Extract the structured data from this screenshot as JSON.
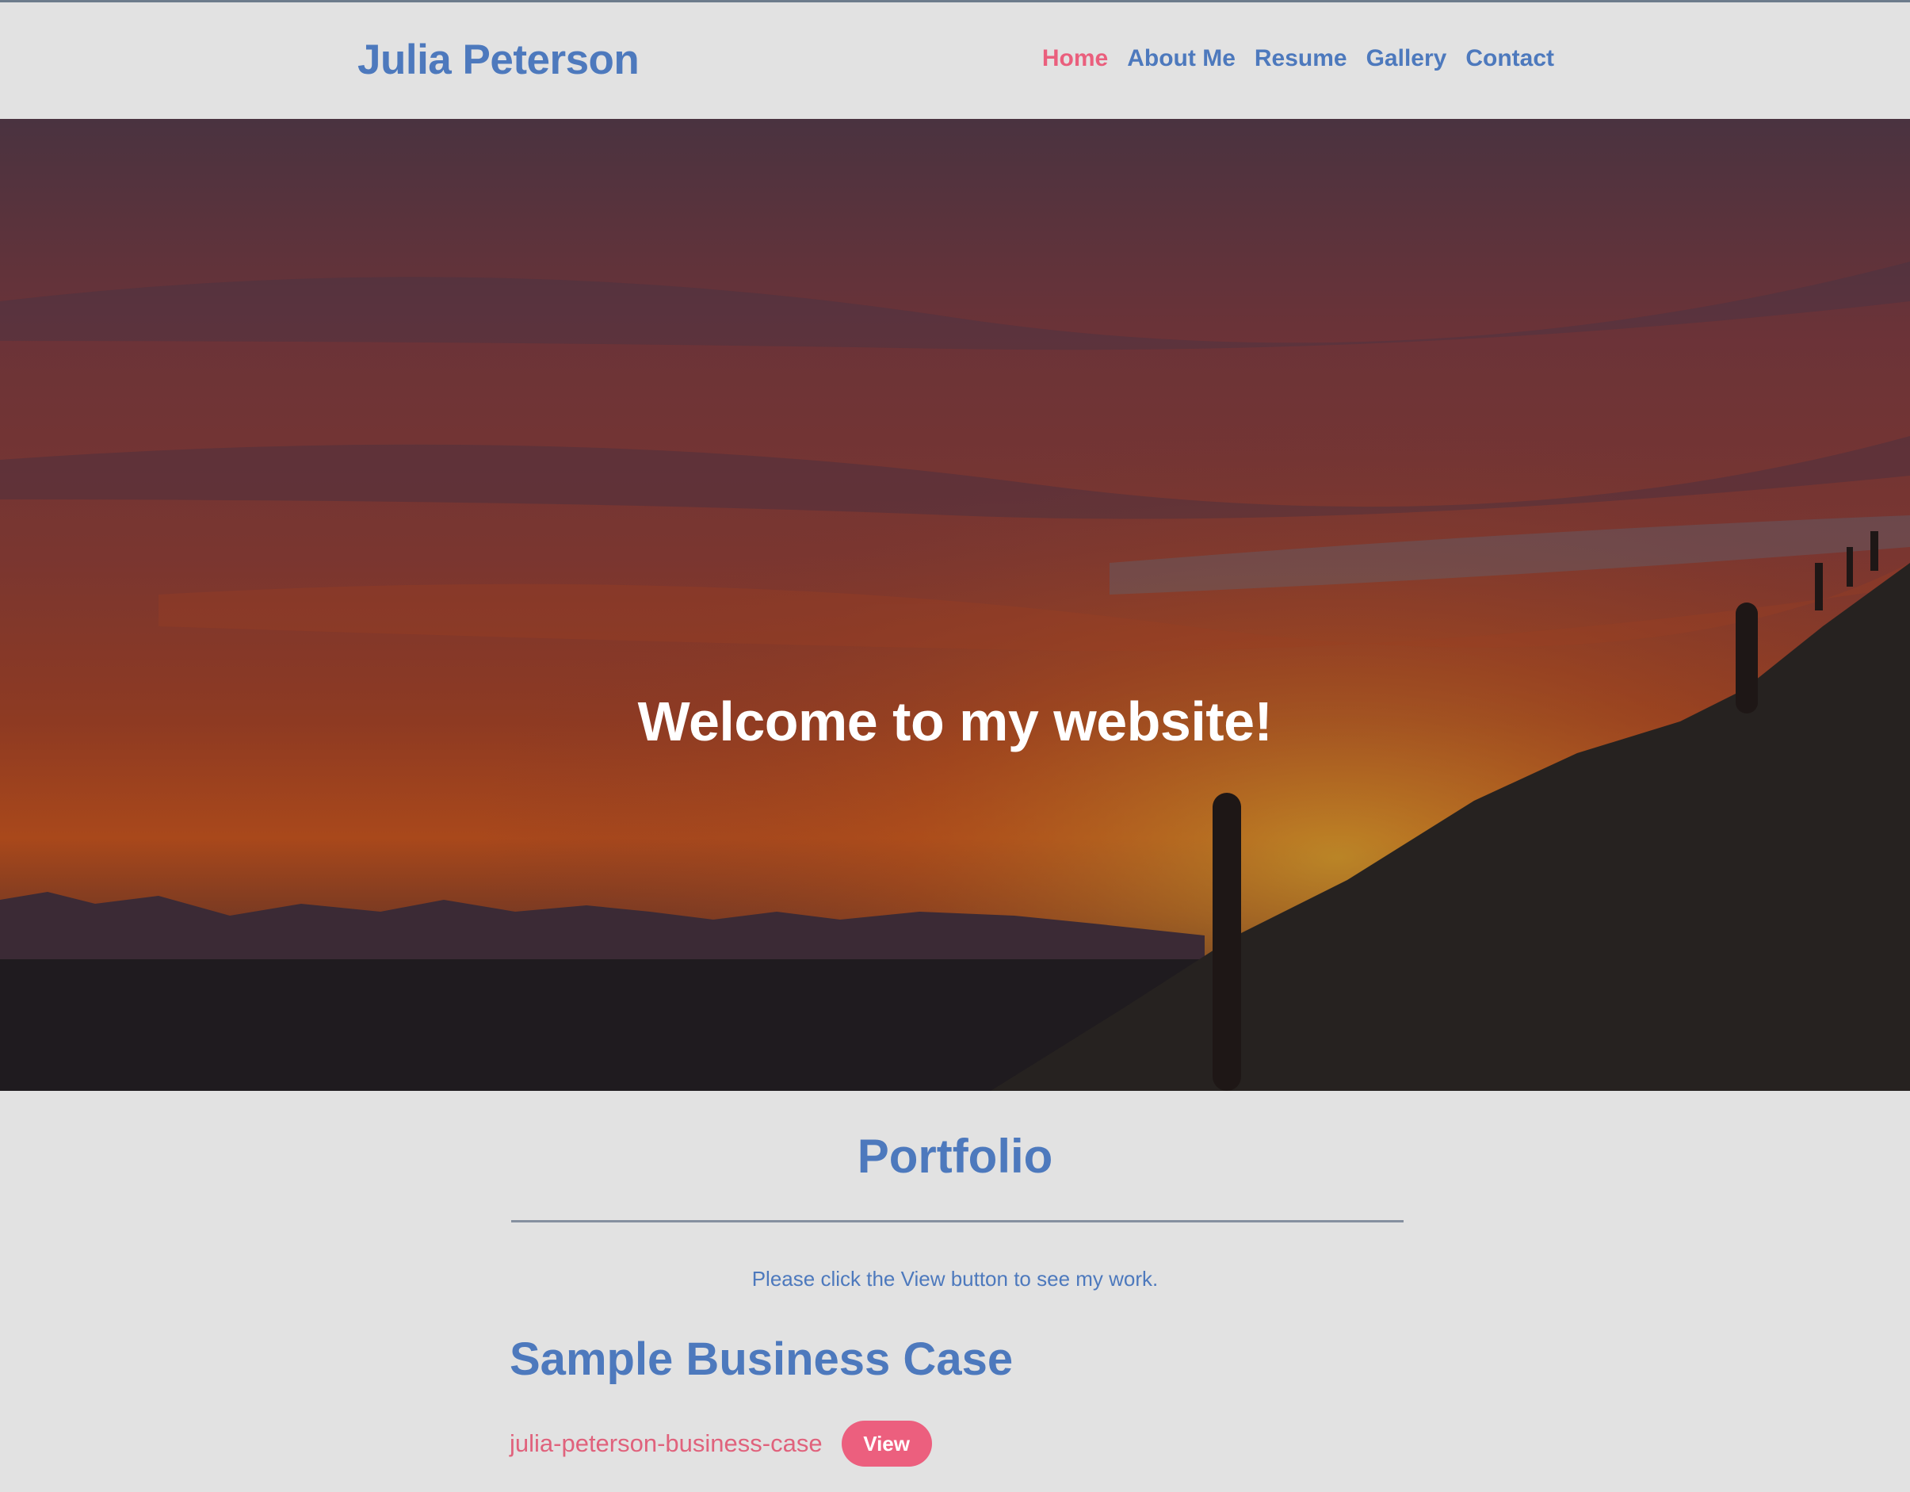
{
  "site": {
    "brand": "Julia Peterson"
  },
  "nav": {
    "items": [
      {
        "label": "Home",
        "active": true
      },
      {
        "label": "About Me",
        "active": false
      },
      {
        "label": "Resume",
        "active": false
      },
      {
        "label": "Gallery",
        "active": false
      },
      {
        "label": "Contact",
        "active": false
      }
    ]
  },
  "hero": {
    "title": "Welcome to my website!"
  },
  "portfolio": {
    "title": "Portfolio",
    "intro": "Please click the View button to see my work.",
    "items": [
      {
        "title": "Sample Business Case",
        "link_text": "julia-peterson-business-case",
        "button_label": "View"
      }
    ]
  },
  "colors": {
    "brand_blue": "#4d79bd",
    "accent_pink": "#ec5f7e",
    "background": "#e2e2e2"
  }
}
